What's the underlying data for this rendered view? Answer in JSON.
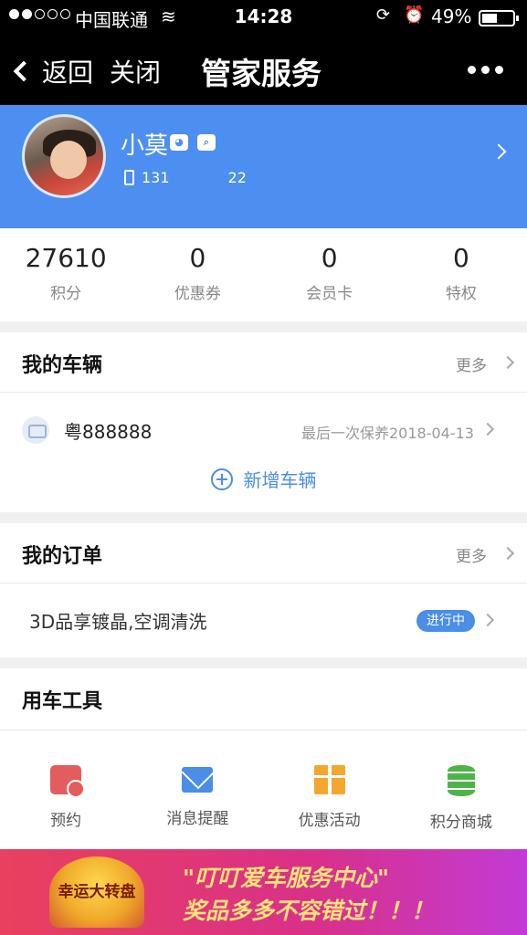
{
  "status_bar": {
    "carrier": "中国联通",
    "time": "14:28",
    "battery": "49%",
    "battery_level": 0.49,
    "signal_icon": "signal-dots-icon",
    "wifi_icon": "wifi-icon"
  },
  "nav": {
    "back_label": "返回",
    "close_label": "关闭",
    "title": "管家服务",
    "more_icon": "more-dots-icon"
  },
  "profile": {
    "name": "小莫",
    "phone": "131    22",
    "accent_color": "#4c8ff0"
  },
  "stats": [
    {
      "value": "27610",
      "label": "积分"
    },
    {
      "value": "0",
      "label": "优惠券"
    },
    {
      "value": "0",
      "label": "会员卡"
    },
    {
      "value": "0",
      "label": "特权"
    }
  ],
  "vehicles": {
    "title": "我的车辆",
    "more": "更多",
    "items": [
      {
        "plate": "粤888888",
        "last_maintenance": "最后一次保养2018-04-13"
      }
    ],
    "add_label": "新增车辆"
  },
  "orders": {
    "title": "我的订单",
    "more": "更多",
    "items": [
      {
        "name": "3D品享镀晶,空调清洗",
        "status": "进行中"
      }
    ]
  },
  "tools": {
    "title": "用车工具",
    "items": [
      {
        "label": "预约",
        "icon": "calendar-icon",
        "color": "#e35d5d"
      },
      {
        "label": "消息提醒",
        "icon": "mail-icon",
        "color": "#4a8ee6"
      },
      {
        "label": "优惠活动",
        "icon": "gift-icon",
        "color": "#f3a72e"
      },
      {
        "label": "积分商城",
        "icon": "coins-icon",
        "color": "#4fb34a"
      }
    ]
  },
  "banner": {
    "badge": "幸运大转盘",
    "line1": "\"叮叮爱车服务中心\"",
    "line2": "奖品多多不容错过！！！"
  }
}
